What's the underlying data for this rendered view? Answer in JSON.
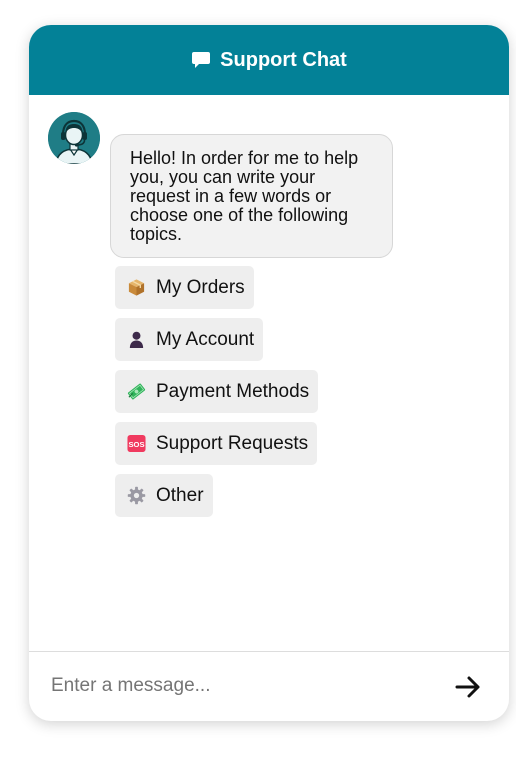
{
  "header": {
    "title": "Support Chat",
    "icon": "chat-bubble-icon",
    "background_color": "#038197"
  },
  "agent": {
    "avatar_icon": "support-agent-headset-icon",
    "greeting": "Hello! In order for me to help you, you can write your request in a few words or choose one of the following topics."
  },
  "topics": [
    {
      "label": "My Orders",
      "icon": "package-icon"
    },
    {
      "label": "My Account",
      "icon": "user-silhouette-icon"
    },
    {
      "label": "Payment Methods",
      "icon": "money-icon"
    },
    {
      "label": "Support Requests",
      "icon": "sos-icon"
    },
    {
      "label": "Other",
      "icon": "gear-icon"
    }
  ],
  "composer": {
    "placeholder": "Enter a message...",
    "send_icon": "arrow-right-icon"
  }
}
